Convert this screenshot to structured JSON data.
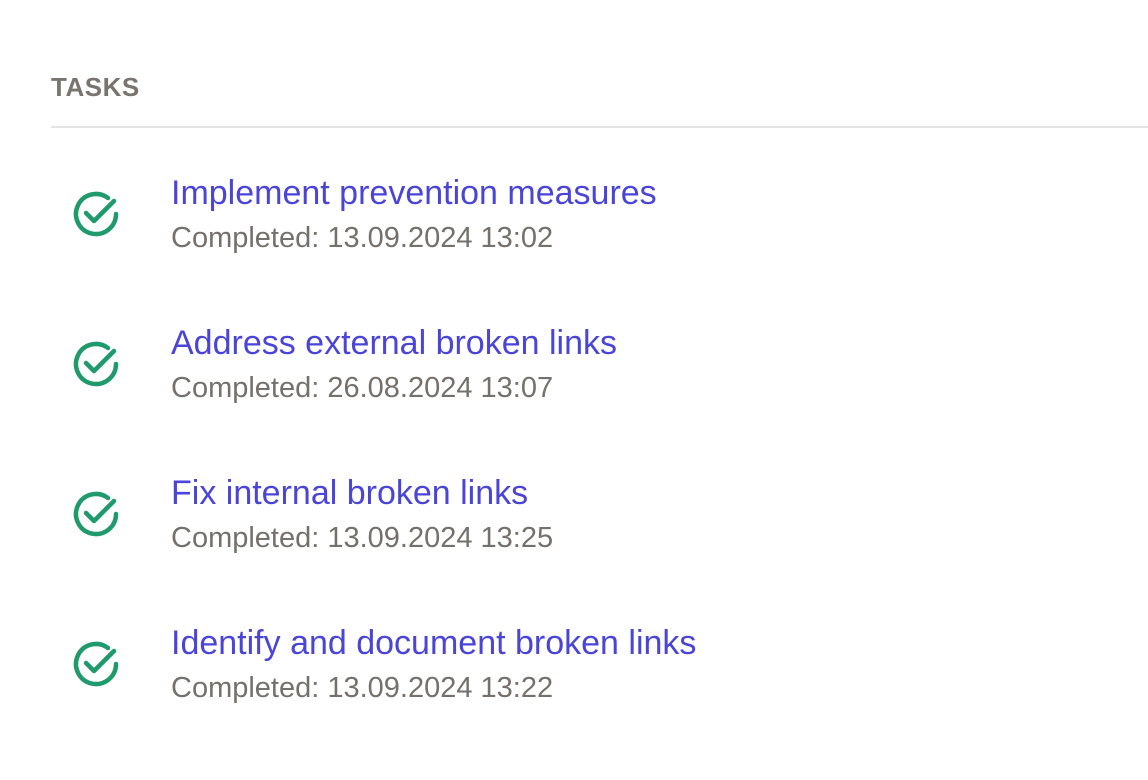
{
  "section": {
    "title": "TASKS"
  },
  "tasks": [
    {
      "title": "Implement prevention measures",
      "status": "Completed: 13.09.2024 13:02",
      "icon": "check-circle-icon"
    },
    {
      "title": "Address external broken links",
      "status": "Completed: 26.08.2024 13:07",
      "icon": "check-circle-icon"
    },
    {
      "title": "Fix internal broken links",
      "status": "Completed: 13.09.2024 13:25",
      "icon": "check-circle-icon"
    },
    {
      "title": "Identify and document broken links",
      "status": "Completed: 13.09.2024 13:22",
      "icon": "check-circle-icon"
    }
  ],
  "colors": {
    "link": "#4a45d8",
    "check": "#1f9a6c",
    "muted_text": "#75706c",
    "header_text": "#7a7470",
    "divider": "#e6e4e2"
  }
}
